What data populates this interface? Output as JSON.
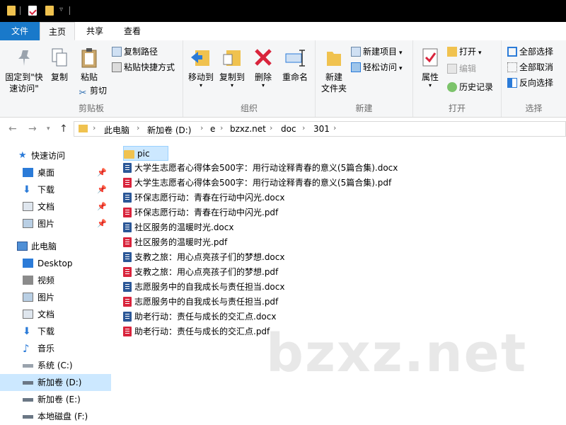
{
  "ribbon_tabs": [
    "文件",
    "主页",
    "共享",
    "查看"
  ],
  "clipboard": {
    "pin_label_1": "固定到\"快",
    "pin_label_2": "速访问\"",
    "copy_label": "复制",
    "paste_label": "粘贴",
    "copy_path_label": "复制路径",
    "paste_shortcut_label": "粘贴快捷方式",
    "cut_label": "剪切",
    "group_label": "剪贴板"
  },
  "organize": {
    "move_to_label": "移动到",
    "copy_to_label": "复制到",
    "delete_label": "删除",
    "rename_label": "重命名",
    "group_label": "组织"
  },
  "new": {
    "new_folder_label_1": "新建",
    "new_folder_label_2": "文件夹",
    "new_item_label": "新建项目",
    "easy_access_label": "轻松访问",
    "group_label": "新建"
  },
  "open": {
    "properties_label": "属性",
    "open_label": "打开",
    "edit_label": "编辑",
    "history_label": "历史记录",
    "group_label": "打开"
  },
  "select": {
    "select_all_label": "全部选择",
    "select_none_label": "全部取消",
    "invert_label": "反向选择",
    "group_label": "选择"
  },
  "breadcrumb": [
    "此电脑",
    "新加卷 (D:)",
    "e",
    "bzxz.net",
    "doc",
    "301"
  ],
  "nav": {
    "quick_access": "快速访问",
    "quick_items": [
      "桌面",
      "下载",
      "文档",
      "图片"
    ],
    "this_pc": "此电脑",
    "pc_items": [
      "Desktop",
      "视频",
      "图片",
      "文档",
      "下载",
      "音乐",
      "系统 (C:)",
      "新加卷 (D:)",
      "新加卷 (E:)",
      "本地磁盘 (F:)"
    ]
  },
  "files": [
    {
      "name": "pic",
      "type": "folder"
    },
    {
      "name": "大学生志愿者心得体会500字：用行动诠释青春的意义(5篇合集).docx",
      "type": "docx"
    },
    {
      "name": "大学生志愿者心得体会500字：用行动诠释青春的意义(5篇合集).pdf",
      "type": "pdf"
    },
    {
      "name": "环保志愿行动：青春在行动中闪光.docx",
      "type": "docx"
    },
    {
      "name": "环保志愿行动：青春在行动中闪光.pdf",
      "type": "pdf"
    },
    {
      "name": "社区服务的温暖时光.docx",
      "type": "docx"
    },
    {
      "name": "社区服务的温暖时光.pdf",
      "type": "pdf"
    },
    {
      "name": "支教之旅：用心点亮孩子们的梦想.docx",
      "type": "docx"
    },
    {
      "name": "支教之旅：用心点亮孩子们的梦想.pdf",
      "type": "pdf"
    },
    {
      "name": "志愿服务中的自我成长与责任担当.docx",
      "type": "docx"
    },
    {
      "name": "志愿服务中的自我成长与责任担当.pdf",
      "type": "pdf"
    },
    {
      "name": "助老行动：责任与成长的交汇点.docx",
      "type": "docx"
    },
    {
      "name": "助老行动：责任与成长的交汇点.pdf",
      "type": "pdf"
    }
  ],
  "watermark": "bzxz.net",
  "colors": {
    "accent": "#1979ca",
    "selection": "#cce8ff",
    "folder": "#f0c24f",
    "word": "#2b5797",
    "pdf": "#d9243c"
  }
}
